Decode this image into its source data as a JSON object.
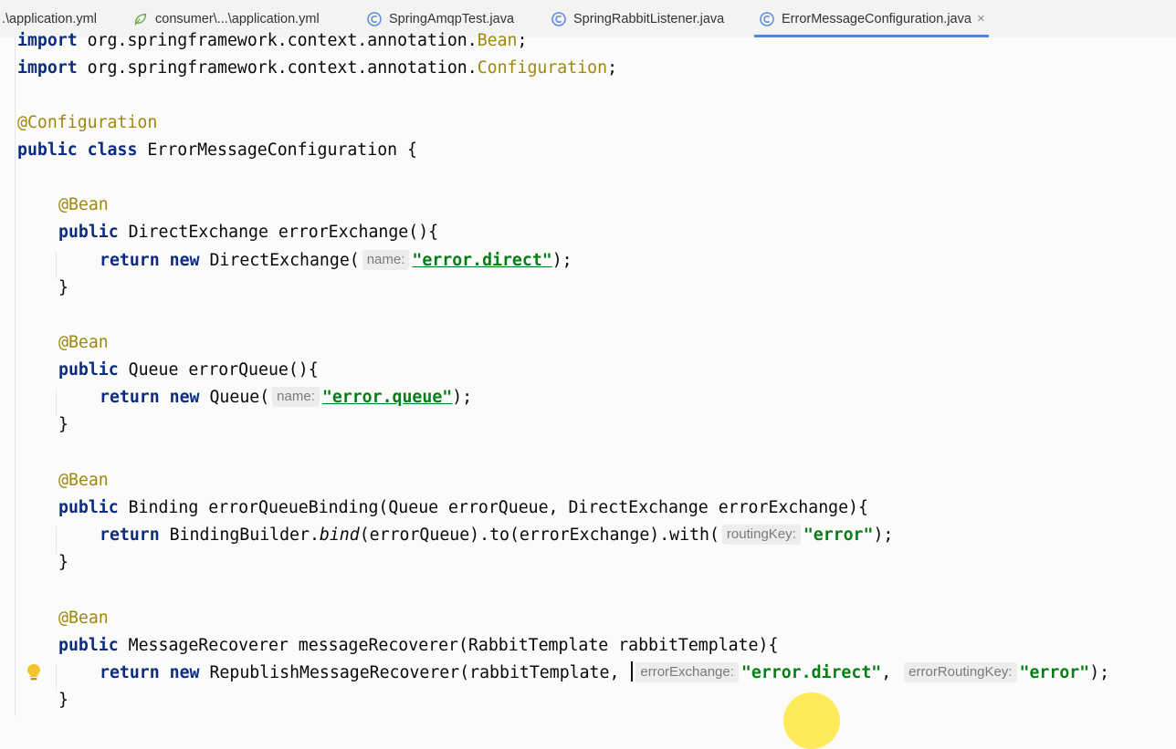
{
  "tabs": [
    {
      "label": ".\\application.yml",
      "icon": "yaml-file-icon",
      "active": false
    },
    {
      "label": "consumer\\...\\application.yml",
      "icon": "spring-leaf-icon",
      "active": false
    },
    {
      "label": "SpringAmqpTest.java",
      "icon": "class-c-icon",
      "active": false
    },
    {
      "label": "SpringRabbitListener.java",
      "icon": "class-c-icon",
      "active": false
    },
    {
      "label": "ErrorMessageConfiguration.java",
      "icon": "class-c-icon",
      "active": true
    }
  ],
  "close_glyph": "×",
  "code": {
    "l1": {
      "kw": "import",
      "pkg": " org.springframework.context.annotation.",
      "cls": "Bean",
      "end": ";"
    },
    "l2": {
      "kw": "import",
      "pkg": " org.springframework.context.annotation.",
      "cls": "Configuration",
      "end": ";"
    },
    "l3": {
      "ann": "@Configuration"
    },
    "l4": {
      "kw1": "public",
      "kw2": "class",
      "rest": " ErrorMessageConfiguration {"
    },
    "l5": {
      "ann": "@Bean"
    },
    "l6": {
      "kw": "public",
      "rest": " DirectExchange errorExchange(){"
    },
    "l7": {
      "kw1": "return",
      "kw2": "new",
      "call": " DirectExchange(",
      "hint": "name:",
      "str": "\"error.direct\"",
      "end": ");"
    },
    "l8": {
      "text": "}"
    },
    "l9": {
      "ann": "@Bean"
    },
    "l10": {
      "kw": "public",
      "rest": " Queue errorQueue(){"
    },
    "l11": {
      "kw1": "return",
      "kw2": "new",
      "call": " Queue(",
      "hint": "name:",
      "str": "\"error.queue\"",
      "end": ");"
    },
    "l12": {
      "text": "}"
    },
    "l13": {
      "ann": "@Bean"
    },
    "l14": {
      "kw": "public",
      "rest": " Binding errorQueueBinding(Queue errorQueue, DirectExchange errorExchange){"
    },
    "l15": {
      "kw": "return",
      "a": " BindingBuilder.",
      "bind": "bind",
      "b": "(errorQueue).to(errorExchange).with(",
      "hint": "routingKey:",
      "str": "\"error\"",
      "end": ");"
    },
    "l16": {
      "text": "}"
    },
    "l17": {
      "ann": "@Bean"
    },
    "l18": {
      "kw": "public",
      "rest": " MessageRecoverer messageRecoverer(RabbitTemplate rabbitTemplate){"
    },
    "l19": {
      "kw1": "return",
      "kw2": "new",
      "call": " RepublishMessageRecoverer(rabbitTemplate, ",
      "hint1": "errorExchange:",
      "str1": "\"error.direct\"",
      "sep": ", ",
      "hint2": "errorRoutingKey:",
      "str2": "\"error\"",
      "end": ");"
    },
    "l20": {
      "text": "}"
    }
  },
  "colors": {
    "keyword": "#0b2c80",
    "annotation": "#9e880d",
    "string": "#067d17",
    "tab_accent": "#4a86e8"
  }
}
